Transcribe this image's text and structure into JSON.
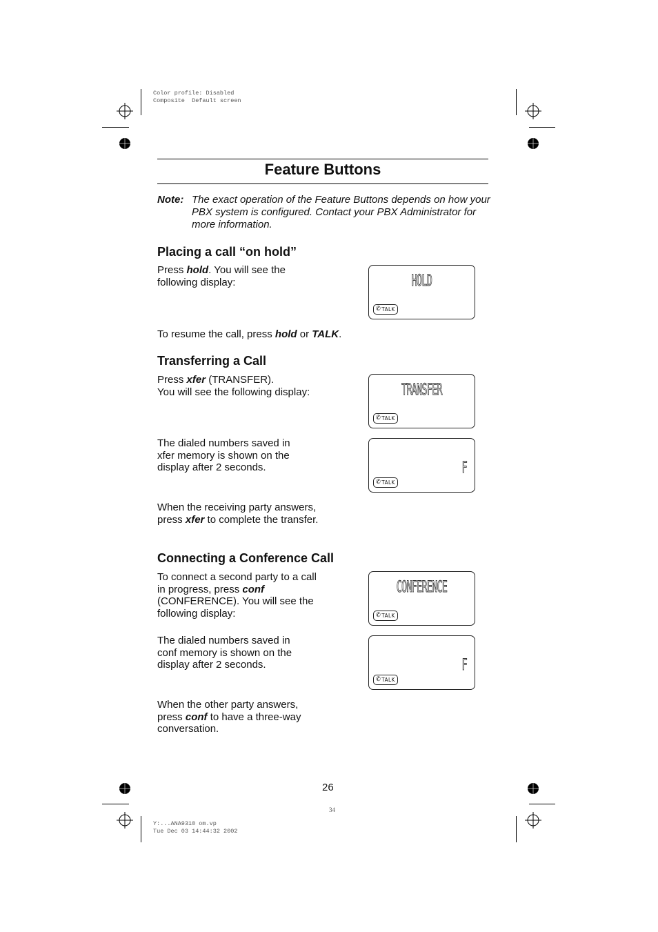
{
  "printer_marks": {
    "top_info": [
      "Color profile: Disabled",
      "Composite  Default screen"
    ],
    "bottom_info": [
      "Y:...ANA9310 om.vp",
      "Tue Dec 03 14:44:32 2002"
    ],
    "sheet_number": "34"
  },
  "page": {
    "title": "Feature Buttons",
    "page_number": "26"
  },
  "note": {
    "label": "Note:",
    "text": "The exact operation of the Feature Buttons depends on how your PBX system is configured. Contact your PBX Administrator for more information."
  },
  "sections": {
    "hold": {
      "heading": "Placing a call “on hold”",
      "p1_a": "Press ",
      "p1_b": "hold",
      "p1_c": ". You will see the following display:",
      "p2_a": "To resume the call, press ",
      "p2_b": "hold",
      "p2_c": " or ",
      "p2_d": "TALK",
      "p2_e": ".",
      "display": "HOLD"
    },
    "transfer": {
      "heading": "Transferring a Call",
      "p1_a": "Press ",
      "p1_b": "xfer",
      "p1_c": " (TRANSFER).",
      "p1_d": "You will see the following display:",
      "p2": "The dialed numbers saved in xfer memory is shown on the display after 2 seconds.",
      "p3_a": "When the receiving party answers, press ",
      "p3_b": "xfer",
      "p3_c": " to complete the transfer.",
      "display1": "TRANSFER",
      "display2": "F"
    },
    "conference": {
      "heading": "Connecting a Conference Call",
      "p1_a": "To connect a second party to a call in progress, press ",
      "p1_b": "conf",
      "p1_c": " (CONFERENCE). You will see the following display:",
      "p2": "The dialed numbers saved in conf memory is shown on the display after 2 seconds.",
      "p3_a": "When the other party answers, press ",
      "p3_b": "conf",
      "p3_c": " to have a three-way conversation.",
      "display1": "CONFERENCE",
      "display2": "F"
    }
  },
  "lcd": {
    "talk_label": "TALK",
    "talk_icon": "phone-handset-icon"
  }
}
